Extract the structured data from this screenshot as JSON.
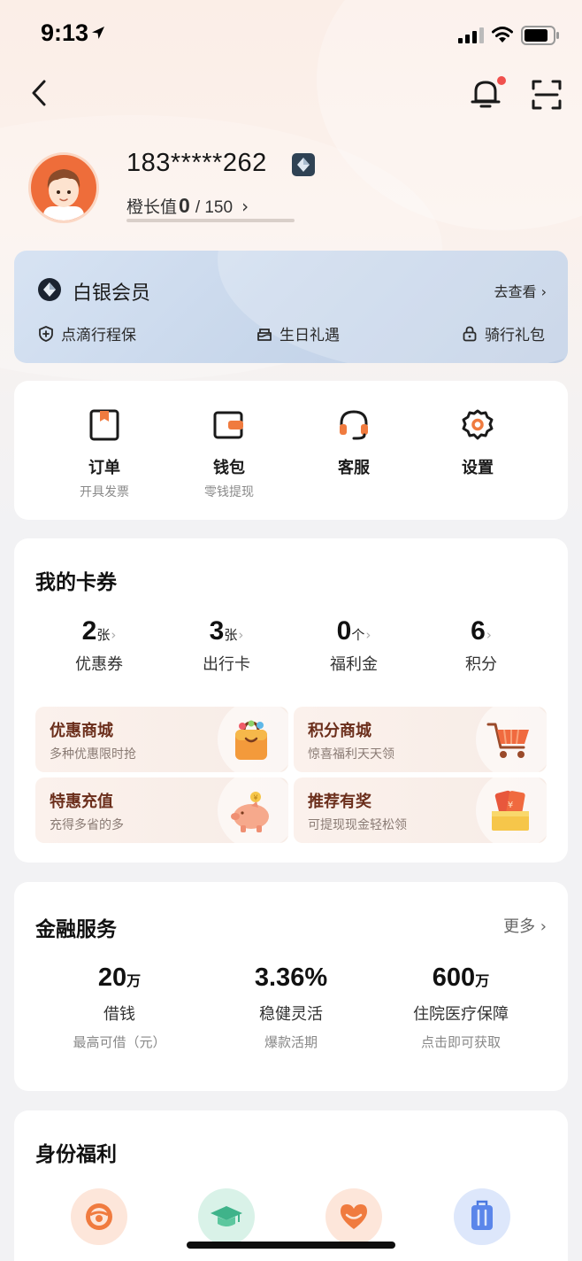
{
  "status_bar": {
    "time": "9:13"
  },
  "profile": {
    "phone": "183*****262",
    "growth_label": "橙长值",
    "growth_value": "0",
    "growth_max": "/ 150",
    "growth_progress": 0
  },
  "member": {
    "title": "白银会员",
    "view_label": "去查看 ›",
    "perks": [
      "点滴行程保",
      "生日礼遇",
      "骑行礼包"
    ]
  },
  "quick_actions": [
    {
      "label": "订单",
      "sub": "开具发票",
      "icon": "order-icon"
    },
    {
      "label": "钱包",
      "sub": "零钱提现",
      "icon": "wallet-icon"
    },
    {
      "label": "客服",
      "sub": "",
      "icon": "headset-icon"
    },
    {
      "label": "设置",
      "sub": "",
      "icon": "gear-icon"
    }
  ],
  "coupons": {
    "title": "我的卡券",
    "stats": [
      {
        "value": "2",
        "unit": "张",
        "label": "优惠券"
      },
      {
        "value": "3",
        "unit": "张",
        "label": "出行卡"
      },
      {
        "value": "0",
        "unit": "个",
        "label": "福利金"
      },
      {
        "value": "6",
        "unit": "",
        "label": "积分"
      }
    ],
    "promos": [
      {
        "title": "优惠商城",
        "sub": "多种优惠限时抢",
        "icon": "shopping-bag-icon"
      },
      {
        "title": "积分商城",
        "sub": "惊喜福利天天领",
        "icon": "shopping-cart-icon"
      },
      {
        "title": "特惠充值",
        "sub": "充得多省的多",
        "icon": "piggy-bank-icon"
      },
      {
        "title": "推荐有奖",
        "sub": "可提现现金轻松领",
        "icon": "red-envelope-icon"
      }
    ]
  },
  "finance": {
    "title": "金融服务",
    "more_label": "更多 ›",
    "items": [
      {
        "value": "20",
        "unit": "万",
        "label": "借钱",
        "sub": "最高可借（元）"
      },
      {
        "value": "3.36%",
        "unit": "",
        "label": "稳健灵活",
        "sub": "爆款活期"
      },
      {
        "value": "600",
        "unit": "万",
        "label": "住院医疗保障",
        "sub": "点击即可获取"
      }
    ]
  },
  "identity": {
    "title": "身份福利",
    "icons": [
      "steering-wheel-icon",
      "graduation-cap-icon",
      "heart-icon",
      "suitcase-icon"
    ]
  },
  "colors": {
    "accent": "#f07b3f",
    "member_card": "#c8d7eb",
    "promo_title": "#6b2e1b",
    "notification_dot": "#f0504d"
  }
}
